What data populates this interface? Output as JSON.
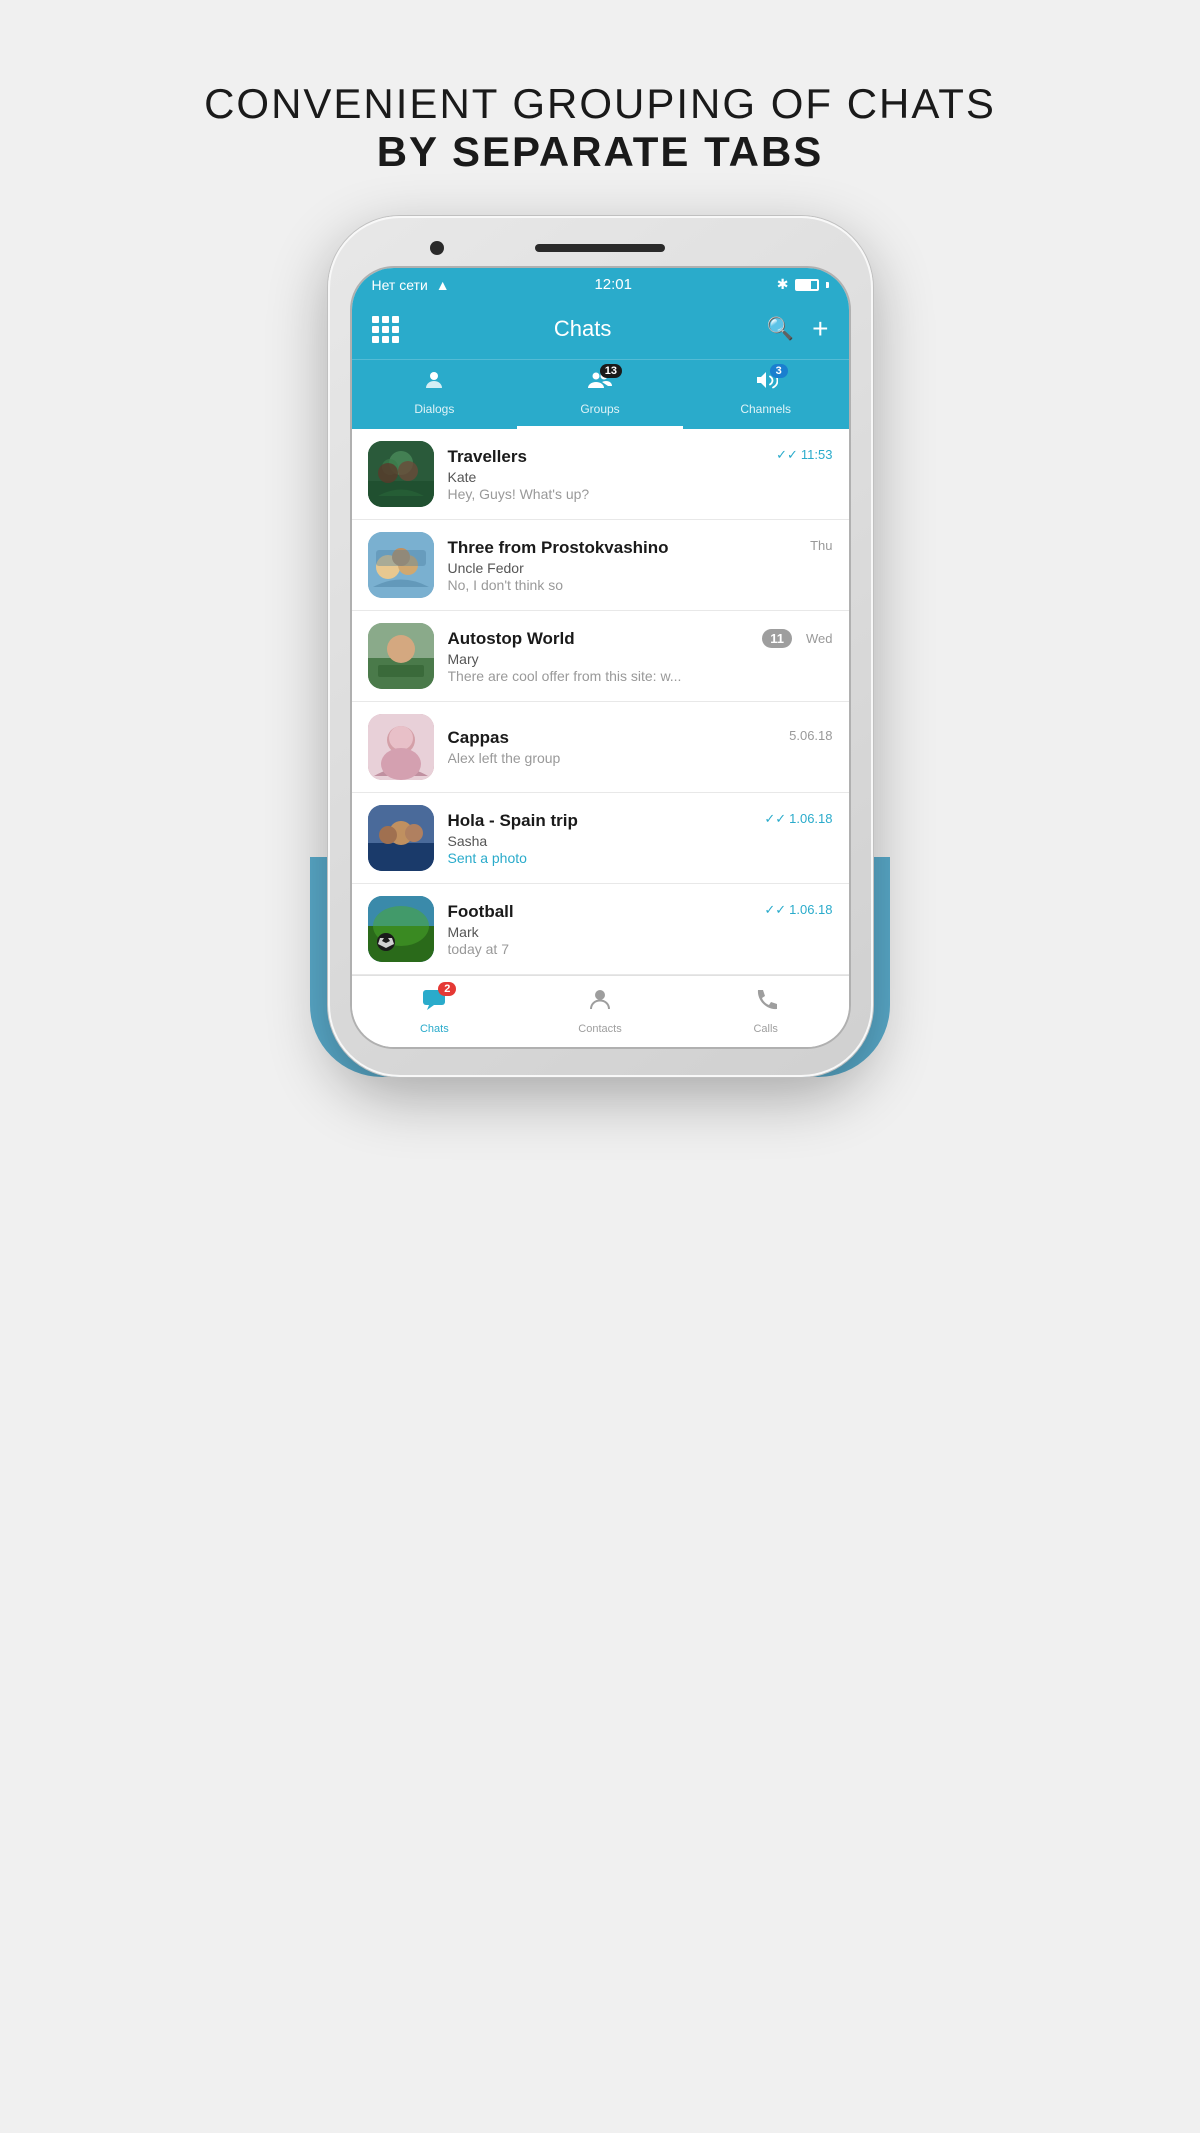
{
  "page": {
    "title_line1": "CONVENIENT GROUPING OF CHATS",
    "title_line2": "BY SEPARATE TABS"
  },
  "status_bar": {
    "network": "Нет сети",
    "time": "12:01",
    "bluetooth": "✱",
    "battery_level": "70"
  },
  "header": {
    "title": "Chats",
    "grid_label": "menu",
    "search_label": "search",
    "add_label": "add"
  },
  "tabs": [
    {
      "id": "dialogs",
      "label": "Dialogs",
      "icon": "👤",
      "badge": null,
      "active": false
    },
    {
      "id": "groups",
      "label": "Groups",
      "icon": "👥",
      "badge": "13",
      "active": true
    },
    {
      "id": "channels",
      "label": "Channels",
      "icon": "📣",
      "badge": "3",
      "active": false
    }
  ],
  "chats": [
    {
      "id": "travellers",
      "name": "Travellers",
      "sender": "Kate",
      "preview": "Hey, Guys! What's up?",
      "time": "11:53",
      "time_class": "read",
      "unread": null,
      "double_check": true
    },
    {
      "id": "prostokvashino",
      "name": "Three from Prostokvashino",
      "sender": "Uncle Fedor",
      "preview": "No, I don't think so",
      "time": "Thu",
      "time_class": "",
      "unread": null,
      "double_check": false
    },
    {
      "id": "autostop",
      "name": "Autostop World",
      "sender": "Mary",
      "preview": "There are cool offer from this site: w...",
      "time": "Wed",
      "time_class": "",
      "unread": "11",
      "double_check": false
    },
    {
      "id": "cappas",
      "name": "Cappas",
      "sender": "",
      "preview": "Alex left the group",
      "time": "5.06.18",
      "time_class": "",
      "unread": null,
      "double_check": false
    },
    {
      "id": "hola",
      "name": "Hola - Spain trip",
      "sender": "Sasha",
      "preview": "Sent a photo",
      "preview_class": "blue",
      "time": "1.06.18",
      "time_class": "read",
      "unread": null,
      "double_check": true
    },
    {
      "id": "football",
      "name": "Football",
      "sender": "Mark",
      "preview": "today at 7",
      "time": "1.06.18",
      "time_class": "read",
      "unread": null,
      "double_check": true
    }
  ],
  "bottom_nav": [
    {
      "id": "chats",
      "label": "Chats",
      "icon": "💬",
      "badge": "2",
      "active": true
    },
    {
      "id": "contacts",
      "label": "Contacts",
      "icon": "👤",
      "badge": null,
      "active": false
    },
    {
      "id": "calls",
      "label": "Calls",
      "icon": "📞",
      "badge": null,
      "active": false
    }
  ]
}
